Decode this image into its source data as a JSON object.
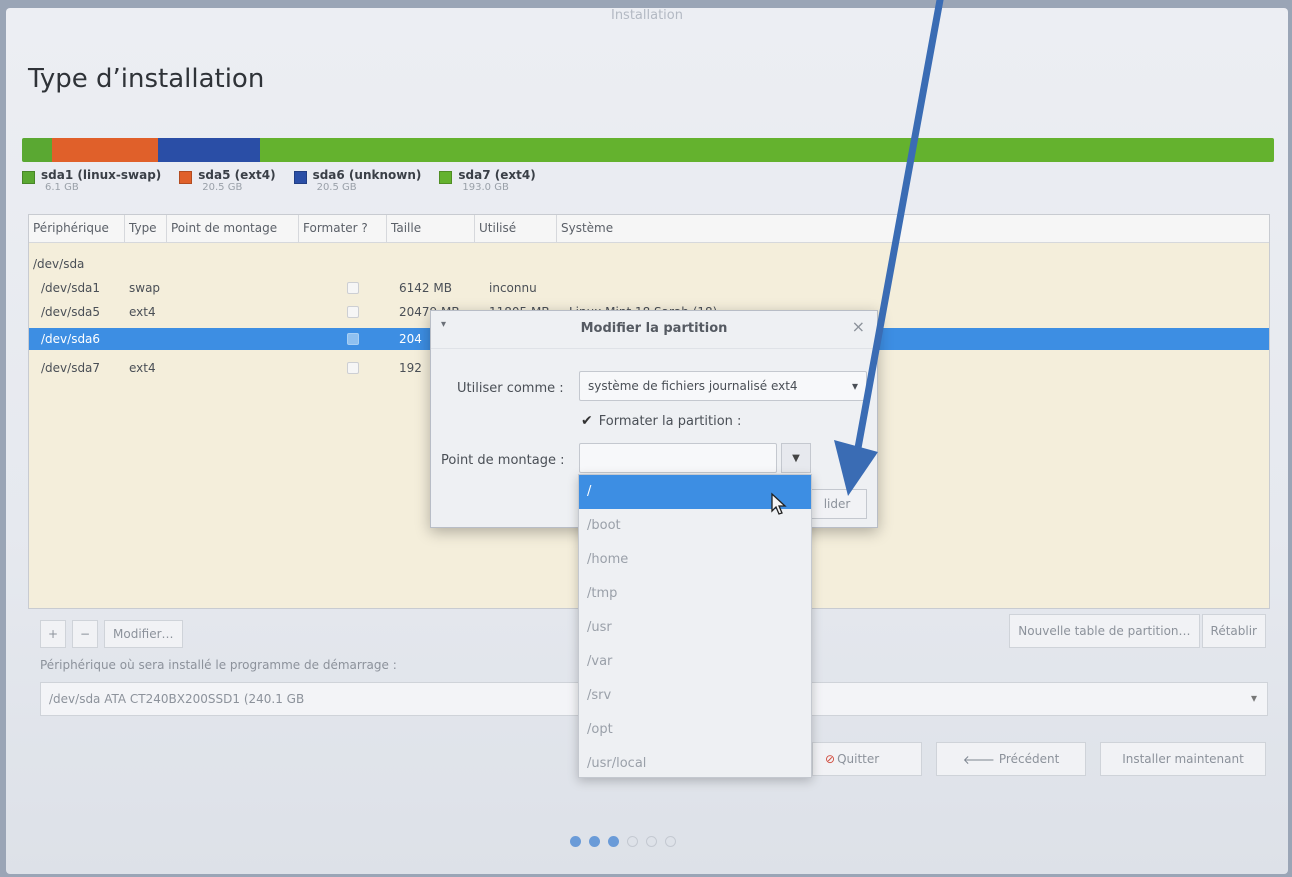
{
  "window_title": "Installation",
  "page_title": "Type d’installation",
  "usage_bar": [
    {
      "color": "#5aa832",
      "share": 0.024
    },
    {
      "color": "#e0602a",
      "share": 0.085
    },
    {
      "color": "#2a4ea6",
      "share": 0.081
    },
    {
      "color": "#64b22e",
      "share": 0.81
    }
  ],
  "legend": [
    {
      "name": "sda1 (linux-swap)",
      "size": "6.1 GB",
      "color": "#5aa832"
    },
    {
      "name": "sda5 (ext4)",
      "size": "20.5 GB",
      "color": "#e0602a"
    },
    {
      "name": "sda6 (unknown)",
      "size": "20.5 GB",
      "color": "#2a4ea6"
    },
    {
      "name": "sda7 (ext4)",
      "size": "193.0 GB",
      "color": "#64b22e"
    }
  ],
  "table": {
    "headers": [
      "Périphérique",
      "Type",
      "Point de montage",
      "Formater ?",
      "Taille",
      "Utilisé",
      "Système"
    ],
    "rows": [
      {
        "device": "/dev/sda",
        "type": "",
        "size": "",
        "used": "",
        "system": ""
      },
      {
        "device": "/dev/sda1",
        "type": "swap",
        "size": "6142 MB",
        "used": "inconnu",
        "system": ""
      },
      {
        "device": "/dev/sda5",
        "type": "ext4",
        "size": "20479 MB",
        "used": "11805 MB",
        "system": "Linux Mint 18 Sarah (18)"
      },
      {
        "device": "/dev/sda6",
        "type": "",
        "size": "204",
        "used": "",
        "system": ""
      },
      {
        "device": "/dev/sda7",
        "type": "ext4",
        "size": "192",
        "used": "",
        "system": ""
      }
    ]
  },
  "bottom_controls": {
    "add": "+",
    "remove": "−",
    "modify": "Modifier…"
  },
  "right_buttons": {
    "new_table": "Nouvelle table de partition…",
    "revert": "Rétablir"
  },
  "bootloader": {
    "label": "Périphérique où sera installé le programme de démarrage :",
    "value": "/dev/sda   ATA CT240BX200SSD1 (240.1 GB"
  },
  "nav": {
    "quit": "Quitter",
    "previous": "Précédent",
    "install": "Installer maintenant"
  },
  "dialog": {
    "title": "Modifier la partition",
    "use_as_label": "Utiliser comme :",
    "use_as_value": "système de fichiers journalisé ext4",
    "format_label": "Formater la partition :",
    "mount_label": "Point de montage :",
    "mount_value": "",
    "validate": "lider"
  },
  "mount_options": [
    "/",
    "/boot",
    "/home",
    "/tmp",
    "/usr",
    "/var",
    "/srv",
    "/opt",
    "/usr/local"
  ],
  "progress_dots": {
    "total": 6,
    "done": 3
  },
  "colors": {
    "accent": "#3d8ee3",
    "annotation_arrow": "#3a6cb4"
  }
}
